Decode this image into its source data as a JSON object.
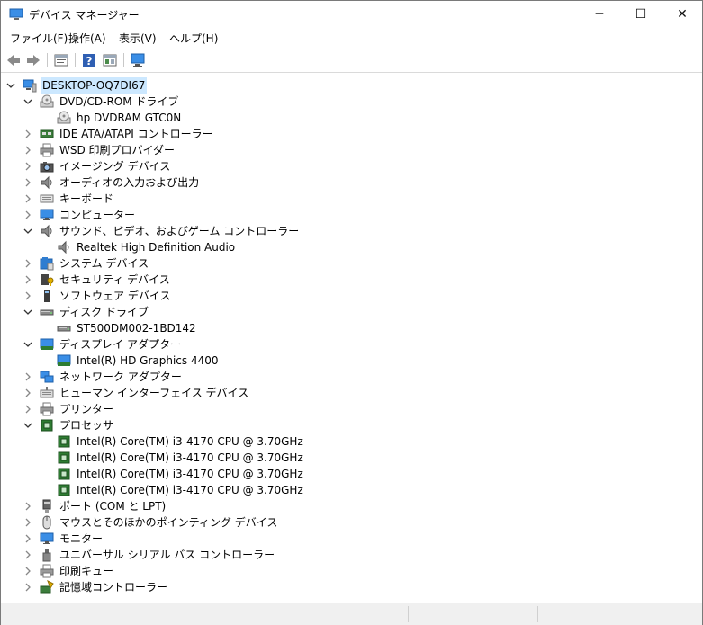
{
  "window": {
    "title": "デバイス マネージャー"
  },
  "window_controls": {
    "minimize": "─",
    "maximize": "☐",
    "close": "✕"
  },
  "menu": [
    "ファイル(F)",
    "操作(A)",
    "表示(V)",
    "ヘルプ(H)"
  ],
  "toolbar": [
    "back-icon",
    "forward-icon",
    "properties-icon",
    "help-icon",
    "view-icon",
    "scan-hardware-icon"
  ],
  "tree": [
    {
      "label": "DESKTOP-OQ7DI67",
      "icon": "computer-root-icon",
      "level": 0,
      "expand": "open",
      "selected": true
    },
    {
      "label": "DVD/CD-ROM ドライブ",
      "icon": "dvd-drive-icon",
      "level": 1,
      "expand": "open"
    },
    {
      "label": "hp DVDRAM GTC0N",
      "icon": "dvd-drive-icon",
      "level": 2,
      "expand": "none"
    },
    {
      "label": "IDE ATA/ATAPI コントローラー",
      "icon": "ide-controller-icon",
      "level": 1,
      "expand": "closed"
    },
    {
      "label": "WSD 印刷プロバイダー",
      "icon": "printer-icon",
      "level": 1,
      "expand": "closed"
    },
    {
      "label": "イメージング デバイス",
      "icon": "camera-icon",
      "level": 1,
      "expand": "closed"
    },
    {
      "label": "オーディオの入力および出力",
      "icon": "speaker-icon",
      "level": 1,
      "expand": "closed"
    },
    {
      "label": "キーボード",
      "icon": "keyboard-icon",
      "level": 1,
      "expand": "closed"
    },
    {
      "label": "コンピューター",
      "icon": "monitor-icon",
      "level": 1,
      "expand": "closed"
    },
    {
      "label": "サウンド、ビデオ、およびゲーム コントローラー",
      "icon": "speaker-icon",
      "level": 1,
      "expand": "open"
    },
    {
      "label": "Realtek High Definition Audio",
      "icon": "speaker-icon",
      "level": 2,
      "expand": "none"
    },
    {
      "label": "システム デバイス",
      "icon": "system-folder-icon",
      "level": 1,
      "expand": "closed"
    },
    {
      "label": "セキュリティ デバイス",
      "icon": "security-key-icon",
      "level": 1,
      "expand": "closed"
    },
    {
      "label": "ソフトウェア デバイス",
      "icon": "software-device-icon",
      "level": 1,
      "expand": "closed"
    },
    {
      "label": "ディスク ドライブ",
      "icon": "disk-drive-icon",
      "level": 1,
      "expand": "open"
    },
    {
      "label": "ST500DM002-1BD142",
      "icon": "disk-drive-icon",
      "level": 2,
      "expand": "none"
    },
    {
      "label": "ディスプレイ アダプター",
      "icon": "display-adapter-icon",
      "level": 1,
      "expand": "open"
    },
    {
      "label": "Intel(R) HD Graphics 4400",
      "icon": "display-adapter-icon",
      "level": 2,
      "expand": "none"
    },
    {
      "label": "ネットワーク アダプター",
      "icon": "network-icon",
      "level": 1,
      "expand": "closed"
    },
    {
      "label": "ヒューマン インターフェイス デバイス",
      "icon": "hid-icon",
      "level": 1,
      "expand": "closed"
    },
    {
      "label": "プリンター",
      "icon": "printer-icon",
      "level": 1,
      "expand": "closed"
    },
    {
      "label": "プロセッサ",
      "icon": "processor-icon",
      "level": 1,
      "expand": "open"
    },
    {
      "label": "Intel(R) Core(TM) i3-4170 CPU @ 3.70GHz",
      "icon": "processor-icon",
      "level": 2,
      "expand": "none"
    },
    {
      "label": "Intel(R) Core(TM) i3-4170 CPU @ 3.70GHz",
      "icon": "processor-icon",
      "level": 2,
      "expand": "none"
    },
    {
      "label": "Intel(R) Core(TM) i3-4170 CPU @ 3.70GHz",
      "icon": "processor-icon",
      "level": 2,
      "expand": "none"
    },
    {
      "label": "Intel(R) Core(TM) i3-4170 CPU @ 3.70GHz",
      "icon": "processor-icon",
      "level": 2,
      "expand": "none"
    },
    {
      "label": "ポート (COM と LPT)",
      "icon": "port-icon",
      "level": 1,
      "expand": "closed"
    },
    {
      "label": "マウスとそのほかのポインティング デバイス",
      "icon": "mouse-icon",
      "level": 1,
      "expand": "closed"
    },
    {
      "label": "モニター",
      "icon": "monitor-icon",
      "level": 1,
      "expand": "closed"
    },
    {
      "label": "ユニバーサル シリアル バス コントローラー",
      "icon": "usb-icon",
      "level": 1,
      "expand": "closed"
    },
    {
      "label": "印刷キュー",
      "icon": "printer-icon",
      "level": 1,
      "expand": "closed"
    },
    {
      "label": "記憶域コントローラー",
      "icon": "storage-controller-icon",
      "level": 1,
      "expand": "closed"
    }
  ],
  "colors": {
    "selection": "#cce8ff",
    "accent": "#0078d7",
    "chip_green": "#2e7d32"
  }
}
